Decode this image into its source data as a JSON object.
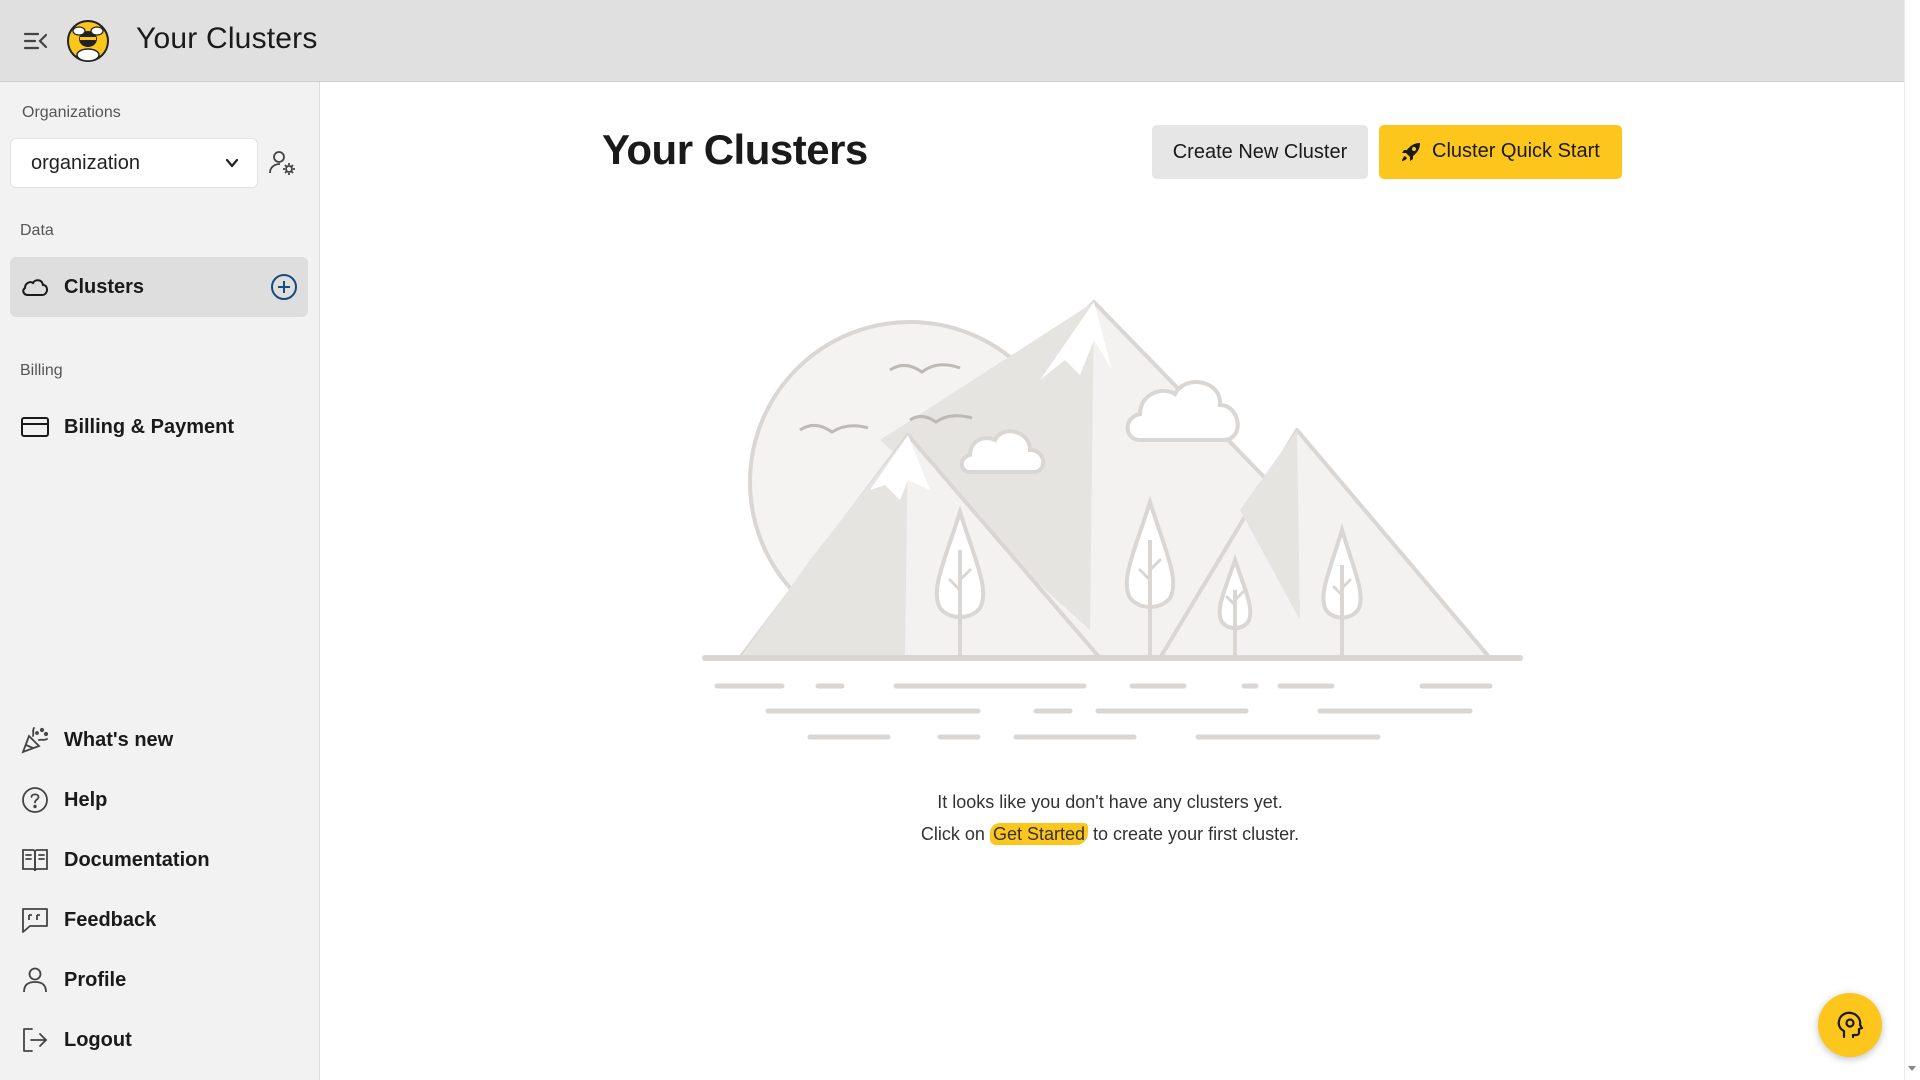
{
  "header": {
    "title": "Your Clusters",
    "menu_icon": "menu-collapse-icon",
    "logo": "bee-logo"
  },
  "sidebar": {
    "organizations_label": "Organizations",
    "org_select_value": "organization",
    "data_label": "Data",
    "billing_label": "Billing",
    "items": [
      {
        "label": "Clusters",
        "icon": "cloud-icon",
        "active": true
      },
      {
        "label": "Billing & Payment",
        "icon": "credit-card-icon"
      }
    ],
    "bottom_items": [
      {
        "label": "What's new",
        "icon": "party-popper-icon"
      },
      {
        "label": "Help",
        "icon": "help-circle-icon"
      },
      {
        "label": "Documentation",
        "icon": "book-icon"
      },
      {
        "label": "Feedback",
        "icon": "feedback-icon"
      },
      {
        "label": "Profile",
        "icon": "user-icon"
      },
      {
        "label": "Logout",
        "icon": "logout-icon"
      }
    ]
  },
  "main": {
    "title": "Your Clusters",
    "create_button": "Create New Cluster",
    "quick_start_button": "Cluster Quick Start",
    "empty_line1": "It looks like you don't have any clusters yet.",
    "empty_line2_prefix": "Click on",
    "empty_line2_highlight": "Get Started",
    "empty_line2_suffix": "to create your first cluster."
  },
  "colors": {
    "accent": "#fcc61d",
    "appbar": "#e0e0e0",
    "sidebar": "#f2f2f2",
    "active_item": "#dedede",
    "add_icon": "#1a4b7a"
  }
}
